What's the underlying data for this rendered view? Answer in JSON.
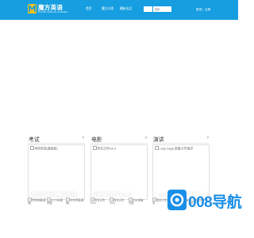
{
  "header": {
    "logo_title": "魔方英语",
    "logo_subtitle": "MOFANG ENGLISH LEARNING",
    "nav": [
      {
        "label": "首页"
      },
      {
        "label": "魔方分类"
      },
      {
        "label": "最新出品"
      }
    ],
    "search": {
      "placeholder": "",
      "button_label": "搜索"
    },
    "login_label": "登录",
    "register_label": "注册",
    "auth_separator": "|"
  },
  "categories": [
    {
      "title": "考试",
      "arrow": "›",
      "feature_alt": "考研英语(基础班)",
      "feature_caption": "考研英语(基础班)",
      "thumbs": [
        {
          "alt": "简单美剧(基础)",
          "caption": "简单美剧(基础)"
        },
        {
          "alt": "CET4全面掌握",
          "caption": "CET4全面掌握"
        },
        {
          "alt": "中考英语(基础)",
          "caption": "中考英语(基础)"
        }
      ]
    },
    {
      "title": "电影",
      "arrow": "›",
      "feature_alt": "阿甘正传Vol.3",
      "feature_caption": "阿甘正传Vol.3",
      "thumbs": [
        {
          "alt": "阿甘正传Vol.1",
          "caption": "阿甘正传Vol.1"
        },
        {
          "alt": "阿甘正传Vol.2",
          "caption": "阿甘正传Vol.2"
        },
        {
          "alt": "功夫熊猫：天赋",
          "caption": "功夫熊猫：天赋"
        }
      ]
    },
    {
      "title": "演讲",
      "arrow": "›",
      "feature_alt": "Lady Gaga 耶鲁大学演讲",
      "feature_caption": "Lady Gaga 耶鲁大学演讲",
      "thumbs": [
        {
          "alt": "耶鲁大学演讲",
          "caption": "耶鲁大学演讲"
        },
        {
          "alt": "美国主流演讲",
          "caption": "美国主流演讲"
        },
        {
          "alt": "哈佛大学演讲",
          "caption": "哈佛大学演讲"
        }
      ]
    }
  ],
  "watermark": {
    "text": "008导航"
  },
  "colors": {
    "header_bg": "#179ee0",
    "logo_accent": "#f4c21d",
    "watermark": "#1a8fe8"
  }
}
